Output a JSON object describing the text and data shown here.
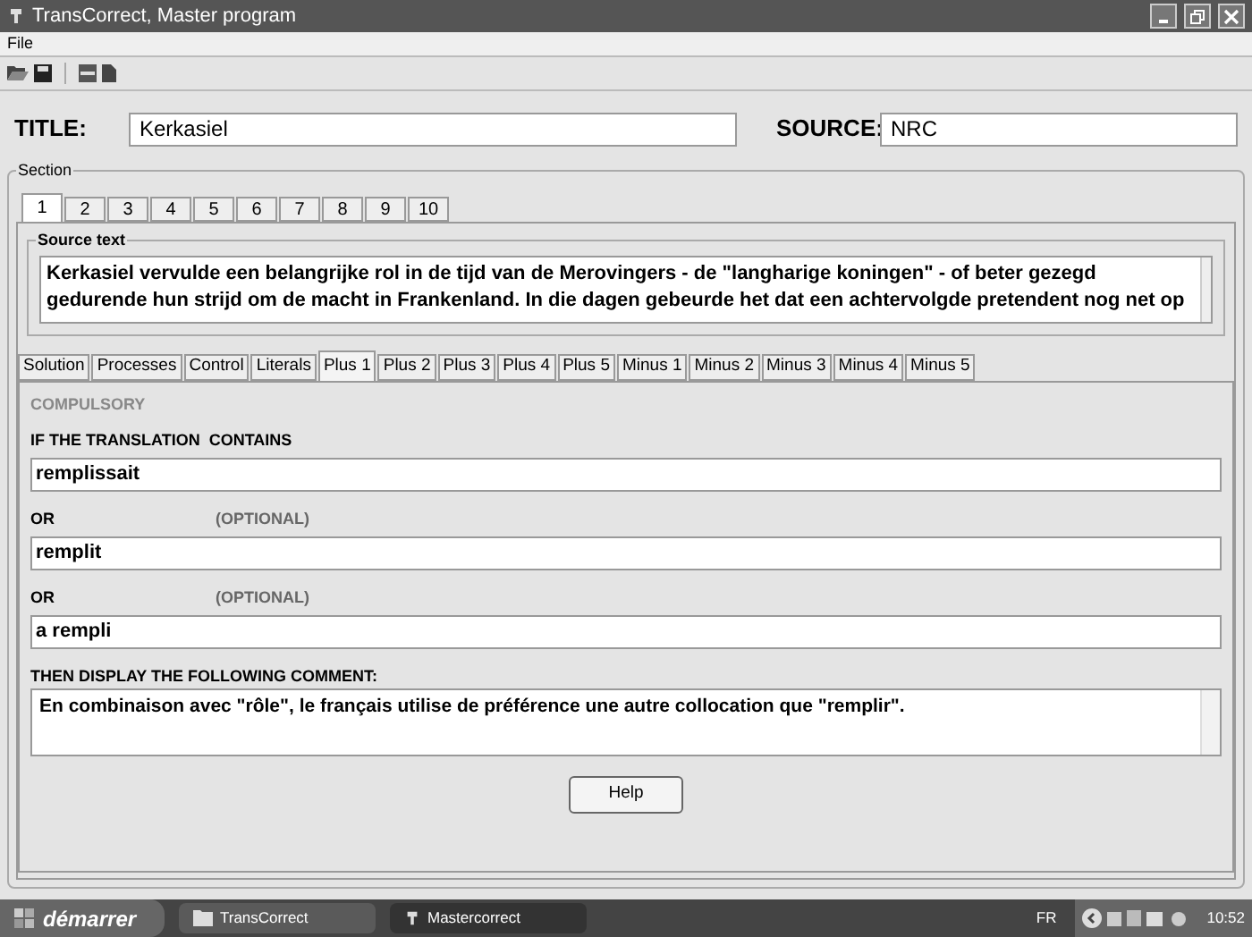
{
  "window": {
    "title": "TransCorrect, Master program"
  },
  "menu": [
    "File"
  ],
  "fields": [
    {
      "label": "TITLE:",
      "value": "Kerkasiel"
    },
    {
      "label": "SOURCE:",
      "value": "NRC"
    }
  ],
  "section": {
    "legend": "Section",
    "tabs": [
      {
        "label": "1",
        "selected": true
      },
      {
        "label": "2",
        "selected": false
      },
      {
        "label": "3",
        "selected": false
      },
      {
        "label": "4",
        "selected": false
      },
      {
        "label": "5",
        "selected": false
      },
      {
        "label": "6",
        "selected": false
      },
      {
        "label": "7",
        "selected": false
      },
      {
        "label": "8",
        "selected": false
      },
      {
        "label": "9",
        "selected": false
      },
      {
        "label": "10",
        "selected": false
      }
    ]
  },
  "source_text": {
    "legend": "Source text",
    "value": "Kerkasiel vervulde een belangrijke rol in de tijd van de Merovingers - de \"langharige koningen\" - of beter gezegd gedurende hun strijd om de macht in Frankenland. In die dagen gebeurde het dat een achtervolgde pretendent nog net op"
  },
  "tabs": [
    {
      "label": "Solution",
      "selected": false
    },
    {
      "label": "Processes",
      "selected": false
    },
    {
      "label": "Control",
      "selected": false
    },
    {
      "label": "Literals",
      "selected": false
    },
    {
      "label": "Plus 1",
      "selected": true
    },
    {
      "label": "Plus 2",
      "selected": false
    },
    {
      "label": "Plus 3",
      "selected": false
    },
    {
      "label": "Plus 4",
      "selected": false
    },
    {
      "label": "Plus 5",
      "selected": false
    },
    {
      "label": "Minus 1",
      "selected": false
    },
    {
      "label": "Minus 2",
      "selected": false
    },
    {
      "label": "Minus 3",
      "selected": false
    },
    {
      "label": "Minus 4",
      "selected": false
    },
    {
      "label": "Minus 5",
      "selected": false
    }
  ],
  "panel": {
    "heading": "COMPULSORY",
    "conditions": [
      {
        "label": "IF THE TRANSLATION  CONTAINS",
        "value": "remplissait"
      },
      {
        "label": "OR",
        "note": "(OPTIONAL)",
        "value": "remplit"
      },
      {
        "label": "OR",
        "note": "(OPTIONAL)",
        "value": "a rempli"
      }
    ],
    "comment_label": "THEN DISPLAY THE FOLLOWING COMMENT:",
    "comment": "En combinaison avec \"rôle\", le français utilise de préférence une autre collocation  que \"remplir\".",
    "button": "Help"
  },
  "taskbar": {
    "start": "démarrer",
    "tasks": [
      {
        "label": "TransCorrect",
        "selected": false
      },
      {
        "label": "Mastercorrect",
        "selected": true
      }
    ],
    "language": "FR",
    "clock": "10:52"
  }
}
